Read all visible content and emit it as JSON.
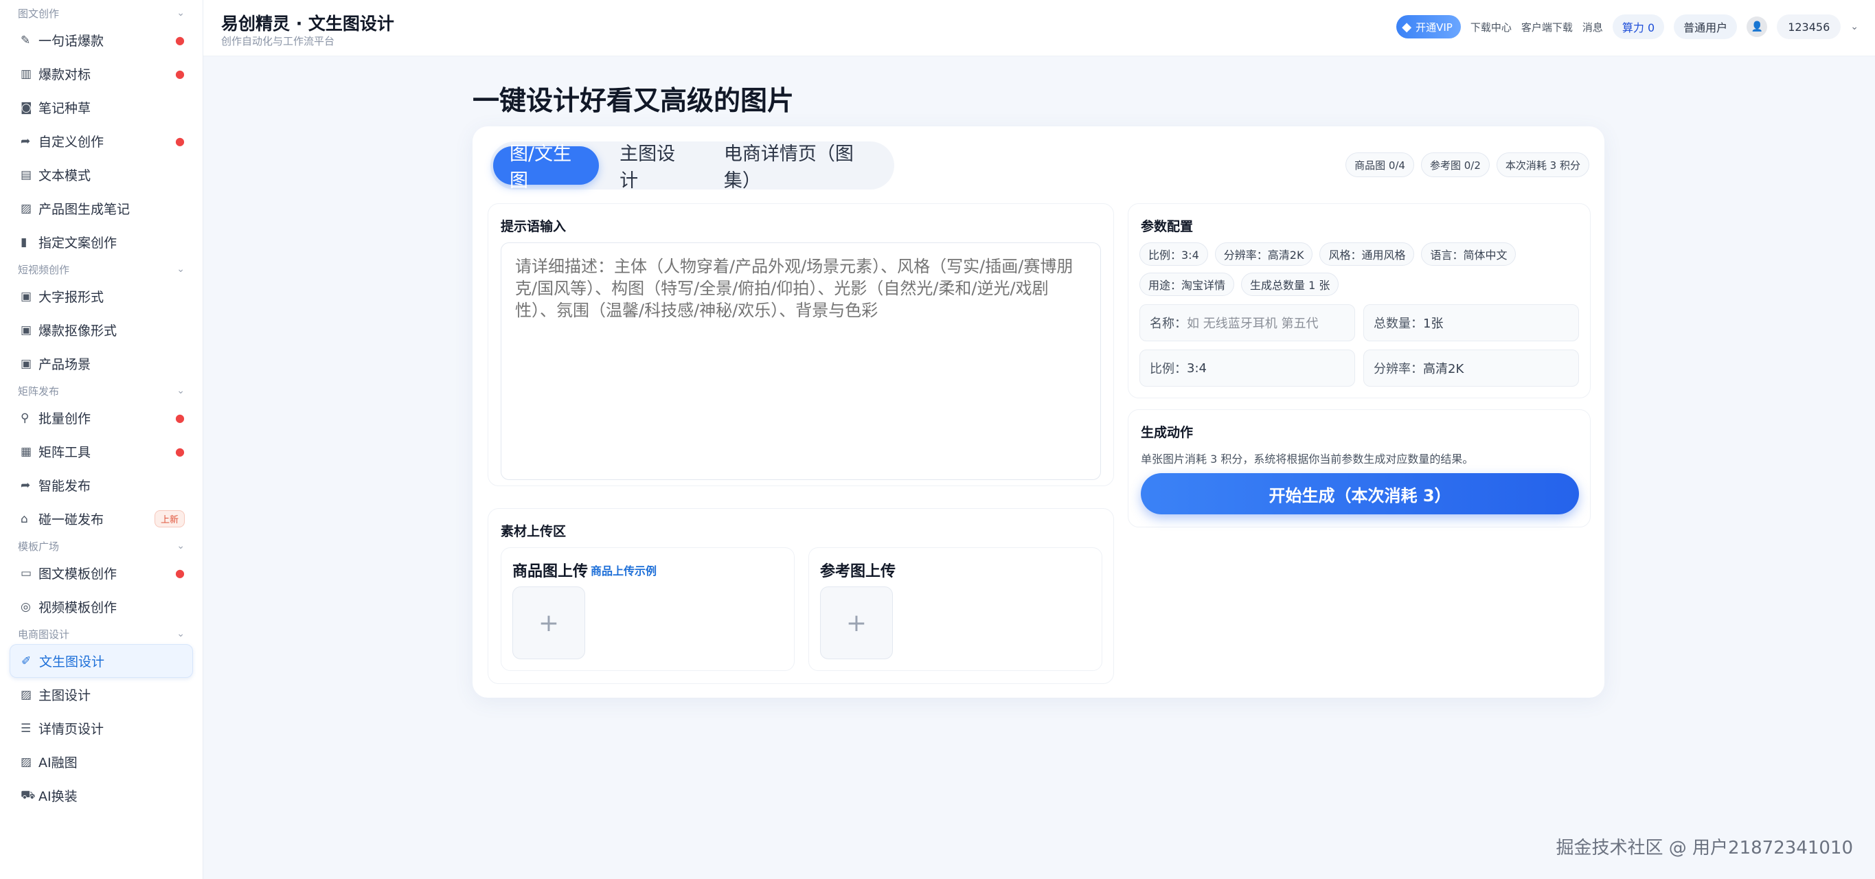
{
  "sidebar": {
    "sections": [
      {
        "title": "图文创作",
        "items": [
          {
            "label": "一句话爆款",
            "icon": "pencil-icon",
            "hot": true
          },
          {
            "label": "爆款对标",
            "icon": "bar-chart-icon",
            "hot": true
          },
          {
            "label": "笔记种草",
            "icon": "camera-icon",
            "hot": false
          },
          {
            "label": "自定义创作",
            "icon": "share-arrow-icon",
            "hot": true
          },
          {
            "label": "文本模式",
            "icon": "text-doc-icon",
            "hot": false
          },
          {
            "label": "产品图生成笔记",
            "icon": "image-icon",
            "hot": false
          },
          {
            "label": "指定文案创作",
            "icon": "doc-icon",
            "hot": false
          }
        ]
      },
      {
        "title": "短视频创作",
        "items": [
          {
            "label": "大字报形式",
            "icon": "calendar-icon",
            "hot": false
          },
          {
            "label": "爆款抠像形式",
            "icon": "calendar-icon",
            "hot": false
          },
          {
            "label": "产品场景",
            "icon": "calendar-icon",
            "hot": false
          }
        ]
      },
      {
        "title": "矩阵发布",
        "items": [
          {
            "label": "批量创作",
            "icon": "network-icon",
            "hot": true
          },
          {
            "label": "矩阵工具",
            "icon": "grid-icon",
            "hot": true
          },
          {
            "label": "智能发布",
            "icon": "share-arrow-icon",
            "hot": false
          },
          {
            "label": "碰一碰发布",
            "icon": "home-icon",
            "hot": false,
            "badge": "上新"
          }
        ]
      },
      {
        "title": "模板广场",
        "items": [
          {
            "label": "图文模板创作",
            "icon": "template-icon",
            "hot": true
          },
          {
            "label": "视频模板创作",
            "icon": "medal-icon",
            "hot": false
          }
        ]
      },
      {
        "title": "电商图设计",
        "items": [
          {
            "label": "文生图设计",
            "icon": "brush-icon",
            "hot": false,
            "active": true
          },
          {
            "label": "主图设计",
            "icon": "image-icon",
            "hot": false
          },
          {
            "label": "详情页设计",
            "icon": "list-doc-icon",
            "hot": false
          },
          {
            "label": "AI融图",
            "icon": "image-icon",
            "hot": false
          },
          {
            "label": "AI换装",
            "icon": "cart-icon",
            "hot": false
          }
        ]
      }
    ]
  },
  "header": {
    "title": "易创精灵 · 文生图设计",
    "subtitle": "创作自动化与工作流平台",
    "vip_label": "开通VIP",
    "download_center": "下载中心",
    "client_download": "客户端下载",
    "messages": "消息",
    "power": "算力 0",
    "user_type": "普通用户",
    "username": "123456"
  },
  "main": {
    "page_title": "一键设计好看又高级的图片",
    "tabs": [
      "图/文生图",
      "主图设计",
      "电商详情页（图集）"
    ],
    "top_chips": [
      "商品图 0/4",
      "参考图 0/2",
      "本次消耗 3 积分"
    ],
    "prompt": {
      "title": "提示语输入",
      "placeholder": "请详细描述：主体（人物穿着/产品外观/场景元素）、风格（写实/插画/赛博朋克/国风等）、构图（特写/全景/俯拍/仰拍）、光影（自然光/柔和/逆光/戏剧性）、氛围（温馨/科技感/神秘/欢乐）、背景与色彩"
    },
    "upload": {
      "title": "素材上传区",
      "product": {
        "title": "商品图上传",
        "example_link": "商品上传示例",
        "add": "+"
      },
      "reference": {
        "title": "参考图上传",
        "add": "+"
      }
    },
    "params": {
      "title": "参数配置",
      "chips": [
        "比例：3:4",
        "分辨率：高清2K",
        "风格：通用风格",
        "语言：简体中文",
        "用途：淘宝详情",
        "生成总数量 1 张"
      ],
      "name_label": "名称：",
      "name_placeholder": "如 无线蓝牙耳机 第五代",
      "total_label": "总数量：",
      "total_value": "1张",
      "ratio_label": "比例：",
      "ratio_value": "3:4",
      "res_label": "分辨率：",
      "res_value": "高清2K"
    },
    "generate": {
      "title": "生成动作",
      "desc": "单张图片消耗 3 积分，系统将根据你当前参数生成对应数量的结果。",
      "button": "开始生成（本次消耗 3）"
    }
  },
  "watermark": "掘金技术社区 @ 用户21872341010",
  "colors": {
    "accent": "#3478f6",
    "hot": "#ef4444",
    "active_bg": "#eef5ff"
  }
}
